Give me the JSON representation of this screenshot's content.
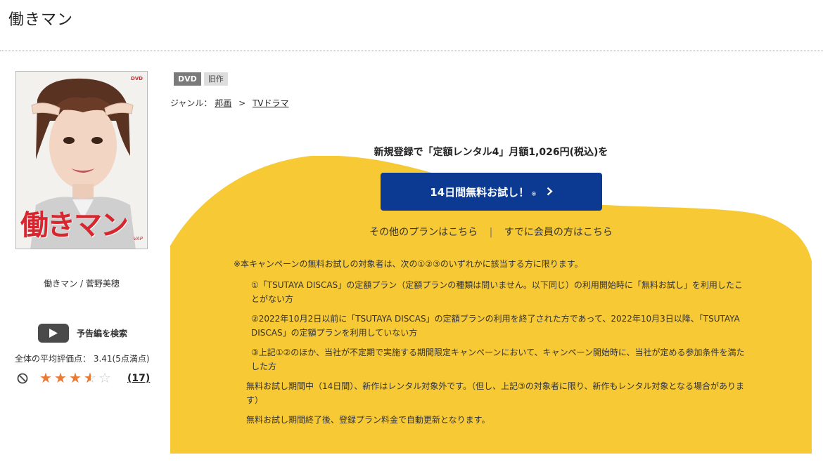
{
  "page": {
    "title": "働きマン"
  },
  "cover": {
    "title": "働きマン",
    "dvd_mark": "DVD",
    "label_mark": "VAP"
  },
  "cast": {
    "text": "働きマン / 菅野美穂"
  },
  "trailer": {
    "label": "予告編を検索"
  },
  "rating": {
    "text": "全体の平均評価点： 3.41(5点満点)",
    "value": 3.41,
    "max": 5,
    "review_count": "(17)"
  },
  "badges": [
    "DVD",
    "旧作"
  ],
  "genre": {
    "label": "ジャンル：",
    "items": [
      "邦画",
      "TVドラマ"
    ],
    "separator": ">"
  },
  "campaign": {
    "title": "新規登録で「定額レンタル4」月額1,026円(税込)を",
    "button_label": "14日間無料お試し！",
    "button_note": "※",
    "other_plans": "その他のプランはこちら",
    "divider": "|",
    "member_login": "すでに会員の方はこちら",
    "notes_intro": "※本キャンペーンの無料お試しの対象者は、次の①②③のいずれかに該当する方に限ります。",
    "conditions": [
      "①「TSUTAYA DISCAS」の定額プラン（定額プランの種類は問いません。以下同じ）の利用開始時に「無料お試し」を利用したことがない方",
      "②2022年10月2日以前に「TSUTAYA DISCAS」の定額プランの利用を終了された方であって、2022年10月3日以降、「TSUTAYA DISCAS」の定額プランを利用していない方",
      "③上記①②のほか、当社が不定期で実施する期間限定キャンペーンにおいて、キャンペーン開始時に、当社が定める参加条件を満たした方"
    ],
    "notes_tail": [
      "無料お試し期間中（14日間）、新作はレンタル対象外です。（但し、上記③の対象者に限り、新作もレンタル対象となる場合があります）",
      "無料お試し期間終了後、登録プラン料金で自動更新となります。"
    ]
  },
  "colors": {
    "accent_blue": "#0c3a93",
    "campaign_yellow": "#f7c935",
    "star_orange": "#e87a33"
  }
}
